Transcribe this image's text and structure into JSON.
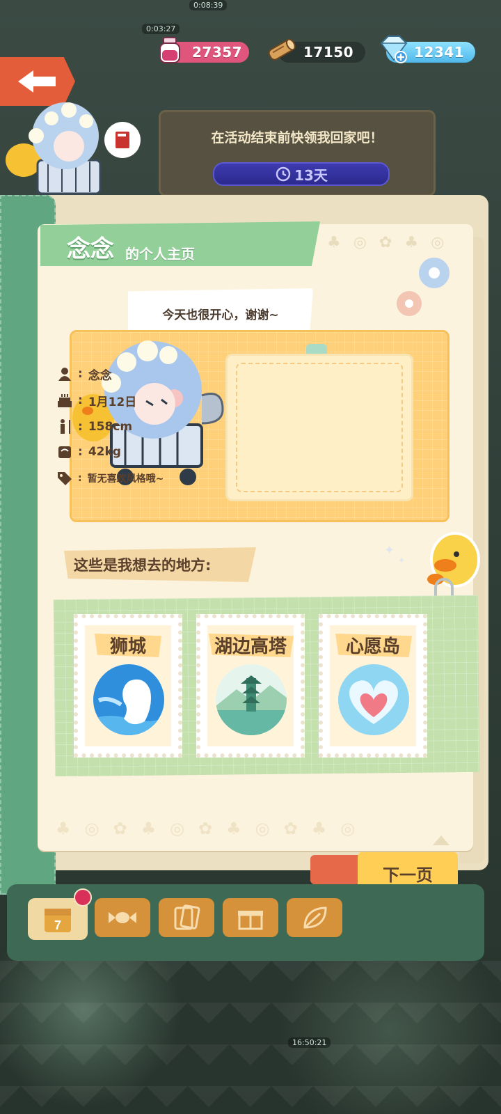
{
  "background": {
    "timers": [
      "0:08:39",
      "0:03:27",
      "16:50:21"
    ]
  },
  "currencies": {
    "ink": {
      "icon": "ink-bottle-icon",
      "value": "27357",
      "color": "#e0557c"
    },
    "wood": {
      "icon": "wood-log-icon",
      "value": "17150",
      "color": "#2a3430"
    },
    "gem": {
      "icon": "diamond-plus-icon",
      "value": "12341",
      "color": "#4fb8ea"
    }
  },
  "event": {
    "message": "在活动结束前快领我回家吧！",
    "timer_icon": "clock-icon",
    "timer": "13天"
  },
  "profile": {
    "name": "念念",
    "title_suffix": "的个人主页",
    "speech": "今天也很开心，谢谢~",
    "rows": [
      {
        "icon": "person-icon",
        "value": "念念"
      },
      {
        "icon": "cake-icon",
        "value": "1月12日"
      },
      {
        "icon": "height-icon",
        "value": "158cm"
      },
      {
        "icon": "scale-icon",
        "value": "42kg"
      },
      {
        "icon": "tag-icon",
        "value": "暂无喜欢风格哦~"
      }
    ],
    "colon": ":"
  },
  "places": {
    "label": "这些是我想去的地方:",
    "items": [
      {
        "name": "狮城",
        "icon": "merlion-icon"
      },
      {
        "name": "湖边高塔",
        "icon": "lake-pagoda-icon"
      },
      {
        "name": "心愿岛",
        "icon": "heart-island-icon"
      }
    ]
  },
  "next_page": "下一页",
  "toolbar": {
    "items": [
      {
        "icon": "calendar-icon",
        "day": "7"
      },
      {
        "icon": "candy-icon"
      },
      {
        "icon": "photo-cards-icon"
      },
      {
        "icon": "gift-box-icon"
      },
      {
        "icon": "leaf-icon"
      }
    ]
  },
  "colors": {
    "page": "#fbf3de",
    "title_tab": "#93cf99",
    "profile_card": "#ffd07a",
    "stamp_board": "#c3e0ad",
    "next_button": "#ffcf55",
    "cover_green": "#5fa681"
  }
}
